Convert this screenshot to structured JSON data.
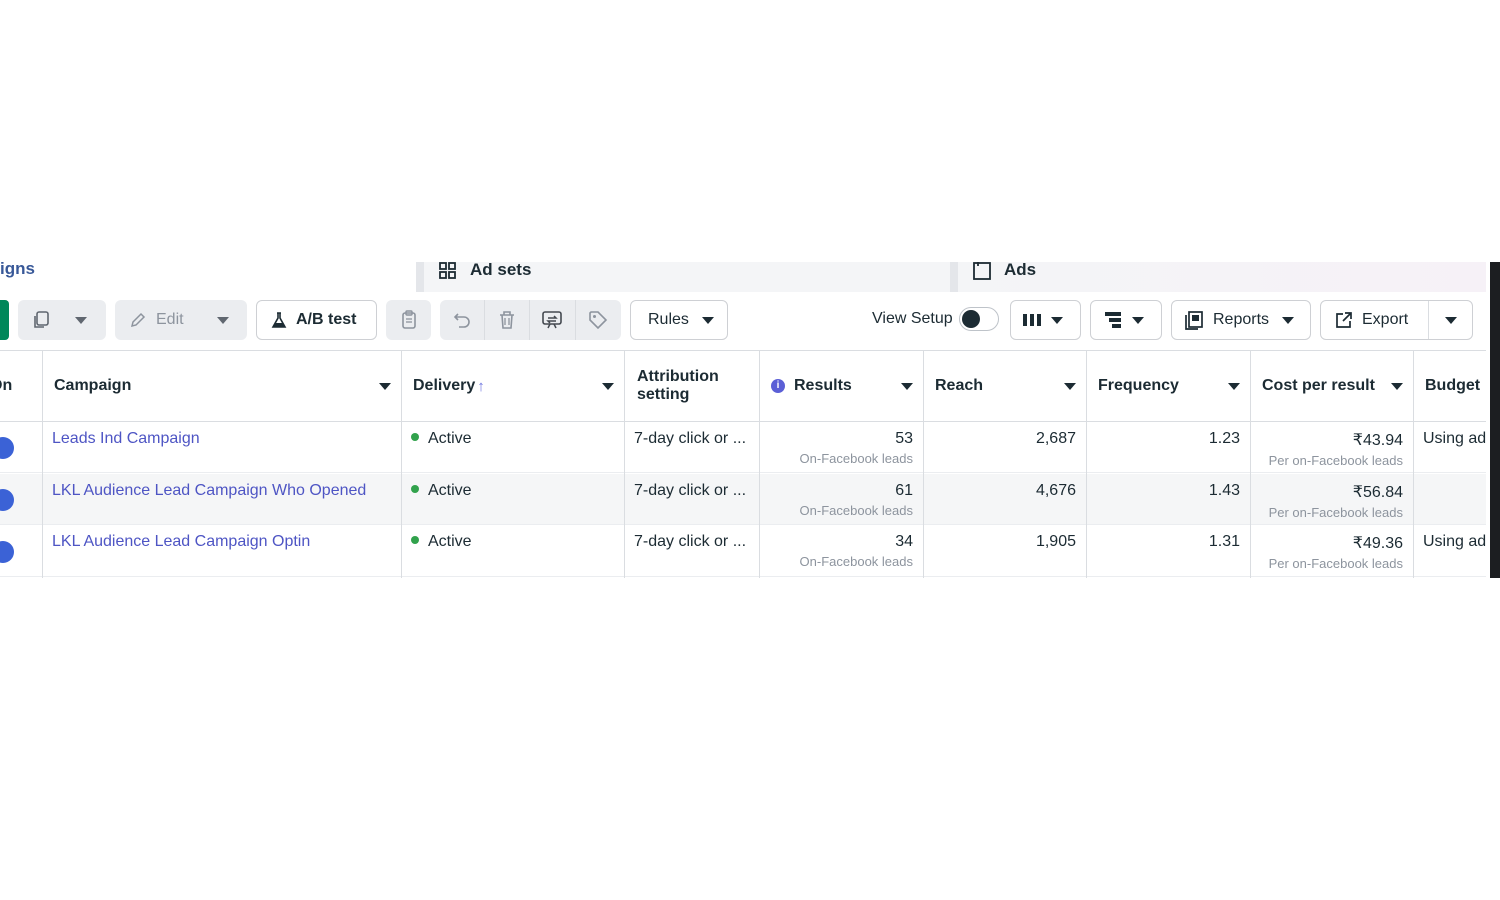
{
  "tabs": {
    "campaigns": "igns",
    "adsets": "Ad sets",
    "ads": "Ads"
  },
  "toolbar": {
    "edit": "Edit",
    "ab_test": "A/B test",
    "rules": "Rules",
    "view_setup": "View Setup",
    "reports": "Reports",
    "export": "Export"
  },
  "table": {
    "headers": {
      "on_off": "On",
      "campaign": "Campaign",
      "delivery": "Delivery",
      "attribution": "Attribution setting",
      "results": "Results",
      "reach": "Reach",
      "frequency": "Frequency",
      "cost_per_result": "Cost per result",
      "budget": "Budget"
    },
    "rows": [
      {
        "campaign": "Leads Ind Campaign",
        "delivery": "Active",
        "attribution": "7-day click or ...",
        "results": "53",
        "results_sub": "On-Facebook leads",
        "reach": "2,687",
        "frequency": "1.23",
        "cost": "₹43.94",
        "cost_sub": "Per on-Facebook leads",
        "budget": "Using ad"
      },
      {
        "campaign": "LKL Audience Lead Campaign Who Opened",
        "delivery": "Active",
        "attribution": "7-day click or ...",
        "results": "61",
        "results_sub": "On-Facebook leads",
        "reach": "4,676",
        "frequency": "1.43",
        "cost": "₹56.84",
        "cost_sub": "Per on-Facebook leads",
        "budget": ""
      },
      {
        "campaign": "LKL Audience Lead Campaign Optin",
        "delivery": "Active",
        "attribution": "7-day click or ...",
        "results": "34",
        "results_sub": "On-Facebook leads",
        "reach": "1,905",
        "frequency": "1.31",
        "cost": "₹49.36",
        "cost_sub": "Per on-Facebook leads",
        "budget": "Using ad"
      }
    ]
  },
  "colors": {
    "link": "#4e55c4",
    "active_dot": "#31a24c",
    "toggle_dot": "#3b62d6",
    "create_green": "#00875a"
  }
}
